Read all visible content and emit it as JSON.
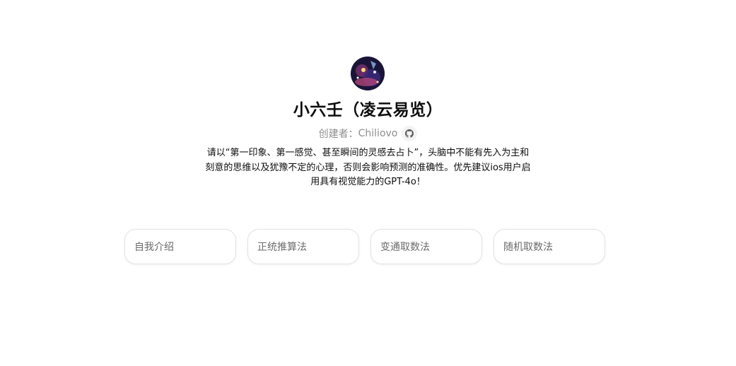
{
  "gpt": {
    "avatar_icon": "avatar-image",
    "title": "小六壬（凌云易览）",
    "creator_prefix": "创建者：",
    "creator_name": "Chiliovo",
    "creator_link_icon": "github-icon",
    "description": "请以“第一印象、第一感觉、甚至瞬间的灵感去占卜”，头脑中不能有先入为主和刻意的思维以及犹豫不定的心理，否则会影响预测的准确性。优先建议ios用户启用具有视觉能力的GPT-4o！"
  },
  "prompt_starters": [
    {
      "label": "自我介绍"
    },
    {
      "label": "正统推算法"
    },
    {
      "label": "变通取数法"
    },
    {
      "label": "随机取数法"
    }
  ]
}
